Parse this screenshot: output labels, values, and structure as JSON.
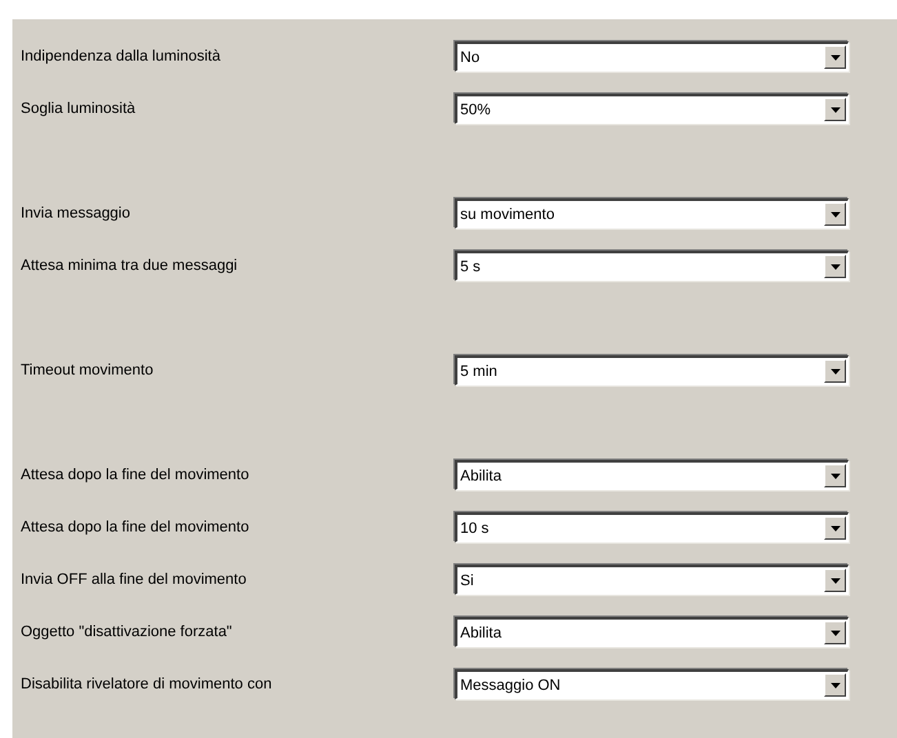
{
  "groups": [
    {
      "rows": [
        {
          "label": "Indipendenza dalla luminosità",
          "value": "No"
        },
        {
          "label": "Soglia luminosità",
          "value": "50%"
        }
      ]
    },
    {
      "rows": [
        {
          "label": "Invia messaggio",
          "value": "su movimento"
        },
        {
          "label": "Attesa minima tra due messaggi",
          "value": "5 s"
        }
      ]
    },
    {
      "rows": [
        {
          "label": "Timeout movimento",
          "value": "5 min"
        }
      ]
    },
    {
      "rows": [
        {
          "label": "Attesa dopo la fine del movimento",
          "value": "Abilita"
        },
        {
          "label": "Attesa dopo la fine del movimento",
          "value": "10 s"
        },
        {
          "label": "Invia OFF alla fine del movimento",
          "value": "Si"
        },
        {
          "label": "Oggetto \"disattivazione forzata\"",
          "value": "Abilita"
        },
        {
          "label": "Disabilita rivelatore di movimento con",
          "value": "Messaggio ON"
        }
      ]
    }
  ]
}
